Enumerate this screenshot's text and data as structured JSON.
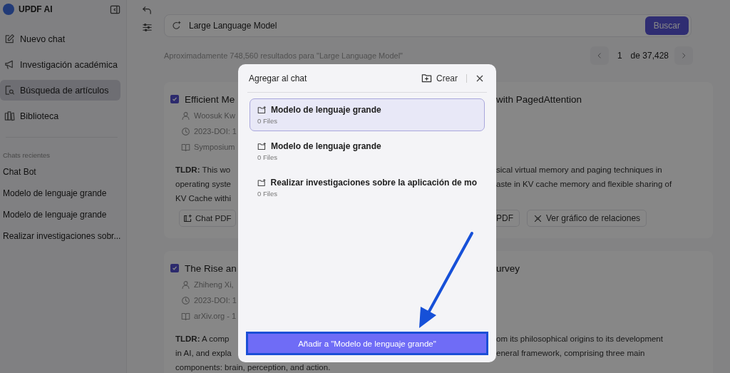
{
  "sidebar": {
    "app_name": "UPDF AI",
    "nav": [
      {
        "label": "Nuevo chat",
        "selected": false
      },
      {
        "label": "Investigación académica",
        "selected": false
      },
      {
        "label": "Búsqueda de artículos",
        "selected": true
      },
      {
        "label": "Biblioteca",
        "selected": false
      }
    ],
    "recent_heading": "Chats recientes",
    "recent_chats": [
      "Chat Bot",
      "Modelo de lenguaje grande",
      "Modelo de lenguaje grande",
      "Realizar investigaciones sobr..."
    ]
  },
  "search": {
    "value": "Large Language Model",
    "button": "Buscar"
  },
  "results_summary": "Aproximadamente 748,560 resultados para \"Large Language Model\"",
  "pager": {
    "page": "1",
    "total": "de 37,428"
  },
  "papers": [
    {
      "checked": true,
      "title_left": "Efficient Me",
      "title_right": "with PagedAttention",
      "authors": "Woosuk Kw",
      "date": "2023-DOI: 1",
      "venue": "Symposium",
      "tldr": [
        {
          "left": "**TLDR:** This wo",
          "right": "sical virtual memory and paging techniques in"
        },
        {
          "left": "operating syste",
          "right": "aste in KV cache memory and flexible sharing of"
        },
        {
          "left": "KV Cache withi"
        }
      ],
      "actions_left": [
        "Chat PDF"
      ],
      "actions_right": [
        "PDF",
        "Ver gráfico de relaciones"
      ]
    },
    {
      "checked": true,
      "title_left": "The Rise an",
      "title_right": "urvey",
      "authors": "Zhiheng Xi,",
      "date": "2023-DOI: 1",
      "venue": "arXiv.org - 1",
      "tldr": [
        {
          "left": "**TLDR:** A comp",
          "right": "om its philosophical origins to its development"
        },
        {
          "left": "in AI, and expla",
          "right": "eneral framework, comprising three main"
        },
        {
          "left": "components: brain, perception, and action."
        }
      ]
    }
  ],
  "dialog": {
    "title": "Agregar al chat",
    "create": "Crear",
    "items": [
      {
        "title": "Modelo de lenguaje grande",
        "subtitle": "0 Files",
        "selected": true
      },
      {
        "title": "Modelo de lenguaje grande",
        "subtitle": "0 Files",
        "selected": false
      },
      {
        "title": "Realizar investigaciones sobre la aplicación de mo",
        "subtitle": "0 Files",
        "selected": false
      }
    ],
    "confirm": "Añadir a \"Modelo de lenguaje grande\""
  }
}
